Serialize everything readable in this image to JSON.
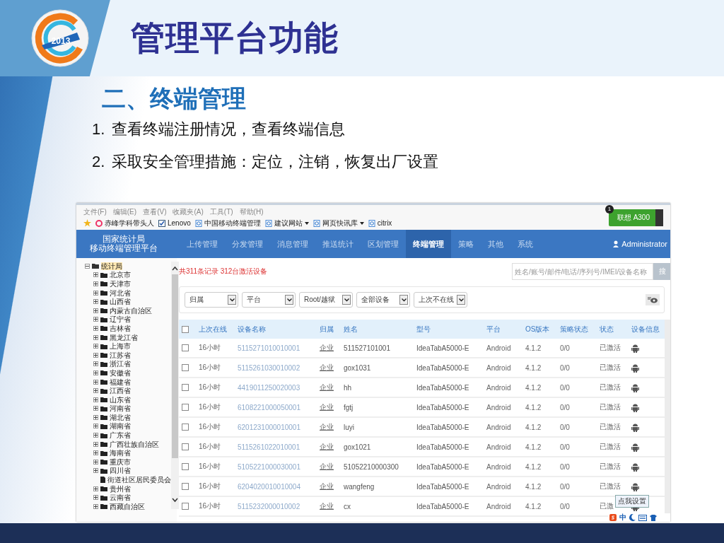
{
  "slide": {
    "logo_text": "2013",
    "title": "管理平台功能",
    "subtitle": "二、终端管理",
    "points": [
      {
        "number": "1.",
        "text": "查看终端注册情况，查看终端信息"
      },
      {
        "number": "2.",
        "text": "采取安全管理措施：定位，注销，恢复出厂设置"
      }
    ]
  },
  "browser": {
    "menu": [
      "文件(F)",
      "编辑(E)",
      "查看(V)",
      "收藏夹(A)",
      "工具(T)",
      "帮助(H)"
    ],
    "favorites": [
      {
        "label": "赤峰学科带头人",
        "kind": "site",
        "dropdown": false
      },
      {
        "label": "Lenovo",
        "kind": "checked",
        "dropdown": false
      },
      {
        "label": "中国移动终端管理",
        "kind": "page",
        "dropdown": false
      },
      {
        "label": "建议网站",
        "kind": "page",
        "dropdown": true
      },
      {
        "label": "网页快讯库",
        "kind": "page",
        "dropdown": true
      },
      {
        "label": "citrix",
        "kind": "page",
        "dropdown": false
      }
    ],
    "notification": {
      "badge": "1",
      "label": "联想 A300"
    }
  },
  "app": {
    "brand": [
      "国家统计局",
      "移动终端管理平台"
    ],
    "nav": [
      {
        "label": "上传管理",
        "selected": false
      },
      {
        "label": "分发管理",
        "selected": false
      },
      {
        "label": "消息管理",
        "selected": false
      },
      {
        "label": "推送统计",
        "selected": false
      },
      {
        "label": "区划管理",
        "selected": false
      },
      {
        "label": "终端管理",
        "selected": true
      },
      {
        "label": "策略",
        "selected": false
      },
      {
        "label": "其他",
        "selected": false
      },
      {
        "label": "系统",
        "selected": false
      }
    ],
    "user": "Administrator",
    "tree": {
      "label": "统计局",
      "expanded": true,
      "selected": true,
      "children": [
        {
          "label": "北京市",
          "expandable": true,
          "selected": false
        },
        {
          "label": "天津市",
          "expandable": true,
          "selected": false
        },
        {
          "label": "河北省",
          "expandable": true,
          "selected": false
        },
        {
          "label": "山西省",
          "expandable": true,
          "selected": false
        },
        {
          "label": "内蒙古自治区",
          "expandable": true,
          "selected": false
        },
        {
          "label": "辽宁省",
          "expandable": true,
          "selected": false
        },
        {
          "label": "吉林省",
          "expandable": true,
          "selected": false
        },
        {
          "label": "黑龙江省",
          "expandable": true,
          "selected": false
        },
        {
          "label": "上海市",
          "expandable": true,
          "selected": false
        },
        {
          "label": "江苏省",
          "expandable": true,
          "selected": false
        },
        {
          "label": "浙江省",
          "expandable": true,
          "selected": false
        },
        {
          "label": "安徽省",
          "expandable": true,
          "selected": false
        },
        {
          "label": "福建省",
          "expandable": true,
          "selected": false
        },
        {
          "label": "江西省",
          "expandable": true,
          "selected": false
        },
        {
          "label": "山东省",
          "expandable": true,
          "selected": false
        },
        {
          "label": "河南省",
          "expandable": true,
          "selected": false
        },
        {
          "label": "湖北省",
          "expandable": true,
          "selected": false
        },
        {
          "label": "湖南省",
          "expandable": true,
          "selected": false
        },
        {
          "label": "广东省",
          "expandable": true,
          "selected": false
        },
        {
          "label": "广西壮族自治区",
          "expandable": true,
          "selected": false
        },
        {
          "label": "海南省",
          "expandable": true,
          "selected": false
        },
        {
          "label": "重庆市",
          "expandable": true,
          "selected": false
        },
        {
          "label": "四川省",
          "expandable": true,
          "selected": false
        },
        {
          "label": "街道社区居民委员会",
          "expandable": false,
          "selected": false
        },
        {
          "label": "贵州省",
          "expandable": true,
          "selected": false
        },
        {
          "label": "云南省",
          "expandable": true,
          "selected": false
        },
        {
          "label": "西藏自治区",
          "expandable": true,
          "selected": false
        }
      ]
    },
    "record_summary": "共311条记录 312台激活设备",
    "search": {
      "placeholder": "姓名/账号/邮件/电话/序列号/IMEI/设备名称",
      "button": "搜"
    },
    "filters": [
      "归属",
      "平台",
      "Root/越狱",
      "全部设备",
      "上次不在线"
    ],
    "table": {
      "header_checked": false,
      "columns": [
        "上次在线",
        "设备名称",
        "归属",
        "姓名",
        "型号",
        "平台",
        "OS版本",
        "策略状态",
        "状态",
        "设备信息"
      ],
      "rows": [
        {
          "checked": false,
          "cells": [
            "16小时",
            "5115271010010001",
            "企业",
            "511527101001",
            "IdeaTabA5000-E",
            "Android",
            "4.1.2",
            "0/0",
            "已激活"
          ]
        },
        {
          "checked": false,
          "cells": [
            "16小时",
            "5115261030010002",
            "企业",
            "gox1031",
            "IdeaTabA5000-E",
            "Android",
            "4.1.2",
            "0/0",
            "已激活"
          ]
        },
        {
          "checked": false,
          "cells": [
            "16小时",
            "4419011250020003",
            "企业",
            "hh",
            "IdeaTabA5000-E",
            "Android",
            "4.1.2",
            "0/0",
            "已激活"
          ]
        },
        {
          "checked": false,
          "cells": [
            "16小时",
            "6108221000050001",
            "企业",
            "fgtj",
            "IdeaTabA5000-E",
            "Android",
            "4.1.2",
            "0/0",
            "已激活"
          ]
        },
        {
          "checked": false,
          "cells": [
            "16小时",
            "6201231000010001",
            "企业",
            "luyi",
            "IdeaTabA5000-E",
            "Android",
            "4.1.2",
            "0/0",
            "已激活"
          ]
        },
        {
          "checked": false,
          "cells": [
            "16小时",
            "5115261022010001",
            "企业",
            "gox1021",
            "IdeaTabA5000-E",
            "Android",
            "4.1.2",
            "0/0",
            "已激活"
          ]
        },
        {
          "checked": false,
          "cells": [
            "16小时",
            "5105221000030001",
            "企业",
            "51052210000300",
            "IdeaTabA5000-E",
            "Android",
            "4.1.2",
            "0/0",
            "已激活"
          ]
        },
        {
          "checked": false,
          "cells": [
            "16小时",
            "6204020010010004",
            "企业",
            "wangfeng",
            "IdeaTabA5000-E",
            "Android",
            "4.1.2",
            "0/0",
            "已激活"
          ]
        },
        {
          "checked": false,
          "cells": [
            "16小时",
            "5115232000010002",
            "企业",
            "cx",
            "IdeaTabA5000-E",
            "Android",
            "4.1.2",
            "0/0",
            "已激"
          ]
        }
      ]
    },
    "tooltip": "点我设置",
    "ime": "中"
  }
}
